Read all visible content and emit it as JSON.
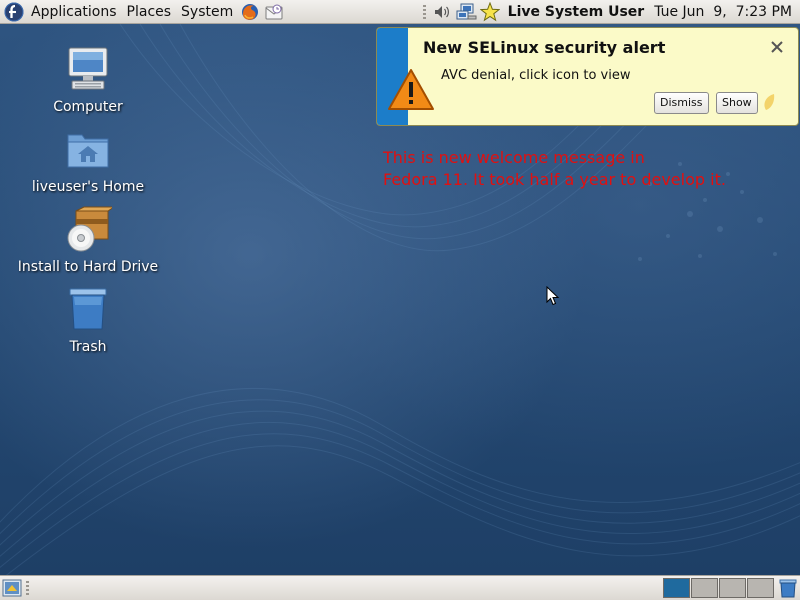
{
  "top_panel": {
    "menus": [
      "Applications",
      "Places",
      "System"
    ],
    "user": "Live System User",
    "clock": "Tue Jun  9,  7:23 PM",
    "launchers": [
      "fedora-logo-icon",
      "firefox-icon",
      "mail-icon"
    ],
    "tray": [
      "volume-icon",
      "network-icon",
      "update-star-icon"
    ]
  },
  "desktop_icons": [
    {
      "label": "Computer",
      "icon": "computer-icon"
    },
    {
      "label": "liveuser's Home",
      "icon": "home-folder-icon"
    },
    {
      "label": "Install to Hard Drive",
      "icon": "install-disc-icon"
    },
    {
      "label": "Trash",
      "icon": "trash-icon"
    }
  ],
  "notification": {
    "title": "New SELinux security alert",
    "body": "AVC denial, click icon to view",
    "buttons": [
      "Dismiss",
      "Show"
    ],
    "accent": "#1c7dc9",
    "background": "#fbfac8"
  },
  "welcome_message": {
    "lines": [
      "This is new welcome message in",
      "Fedora 11. It took half a year to develop it."
    ],
    "color": "#e11010"
  },
  "bottom_panel": {
    "workspaces": 4,
    "active_workspace": 1
  }
}
